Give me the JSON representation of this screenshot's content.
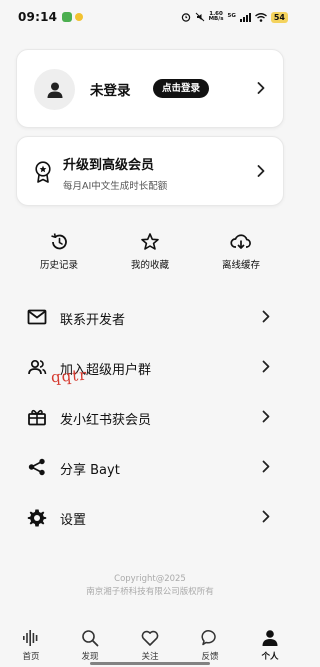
{
  "status_bar": {
    "time": "09:14",
    "speed_top": "1.60",
    "speed_bottom": "MB/s",
    "network": "5G",
    "battery": "54"
  },
  "login_card": {
    "title": "未登录",
    "button_label": "点击登录"
  },
  "premium_card": {
    "title": "升级到高级会员",
    "subtitle": "每月AI中文生成时长配额"
  },
  "quick_actions": [
    {
      "label": "历史记录",
      "icon": "history-icon"
    },
    {
      "label": "我的收藏",
      "icon": "star-icon"
    },
    {
      "label": "离线缓存",
      "icon": "cloud-download-icon"
    }
  ],
  "menu": [
    {
      "label": "联系开发者",
      "icon": "mail-icon"
    },
    {
      "label": "加入超级用户群",
      "icon": "group-icon"
    },
    {
      "label": "发小红书获会员",
      "icon": "gift-icon"
    },
    {
      "label": "分享 Bayt",
      "icon": "share-icon"
    },
    {
      "label": "设置",
      "icon": "gear-icon"
    }
  ],
  "handwritten_note": "qqtr",
  "footer": {
    "copyright": "Copyright@2025",
    "company": "南京湘子桥科技有限公司版权所有"
  },
  "bottom_nav": [
    {
      "label": "首页",
      "icon": "waveform-icon"
    },
    {
      "label": "发现",
      "icon": "search-icon"
    },
    {
      "label": "关注",
      "icon": "heart-icon"
    },
    {
      "label": "反馈",
      "icon": "chat-icon"
    },
    {
      "label": "个人",
      "icon": "person-icon",
      "active": true
    }
  ],
  "colors": {
    "background": "#f6f6f6",
    "card": "#ffffff",
    "accent": "#111111",
    "battery": "#f4d35e"
  }
}
